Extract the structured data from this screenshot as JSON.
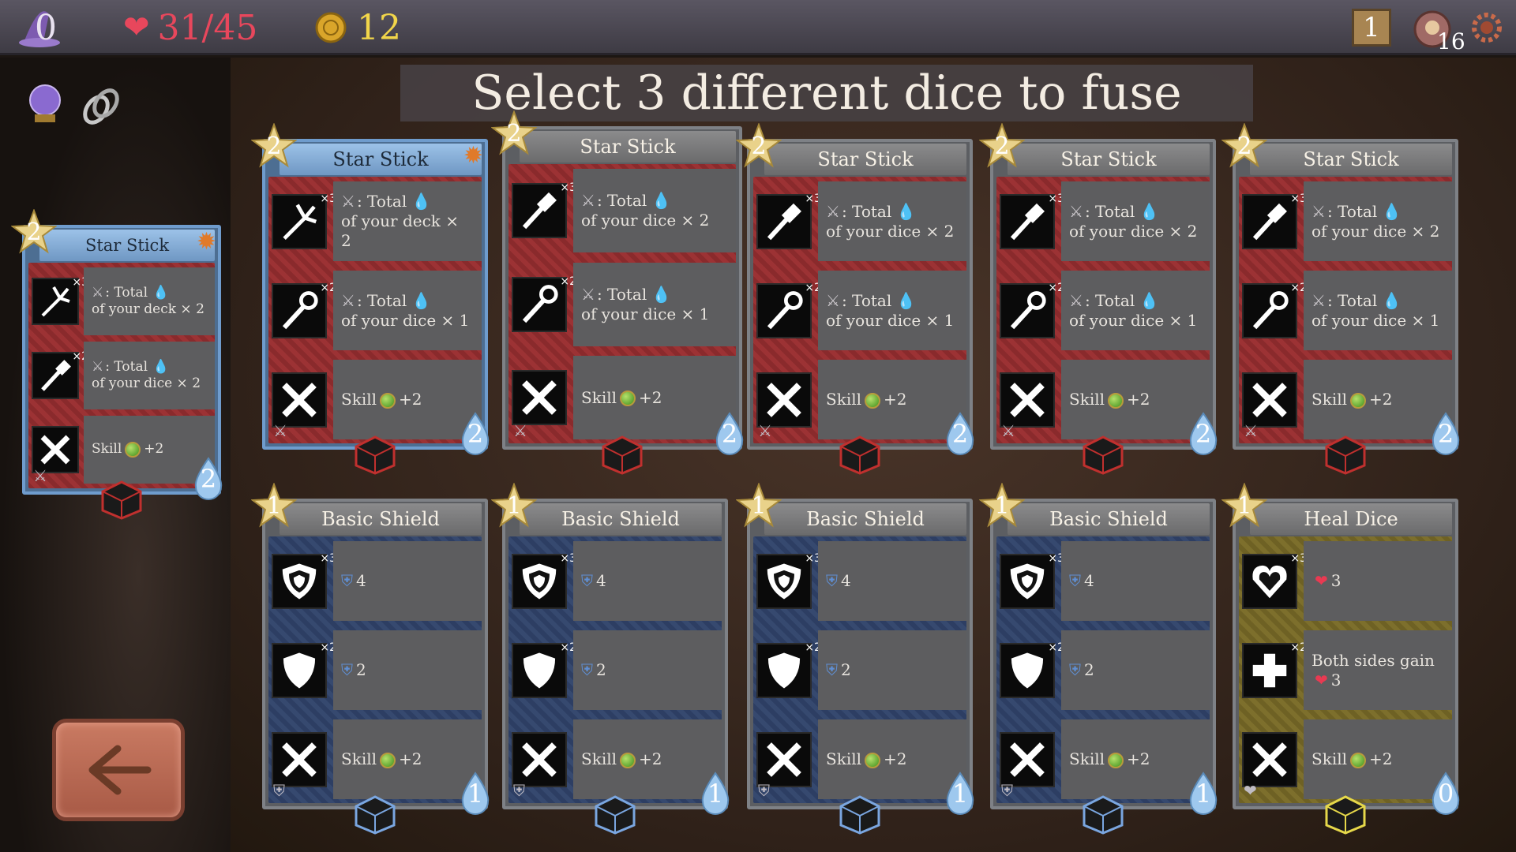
{
  "topbar": {
    "hat_count": "0",
    "health": "31/45",
    "gold": "12",
    "map_number": "1",
    "potion_count": "16"
  },
  "title": "Select 3 different dice to fuse",
  "left_card": {
    "name": "Star Stick",
    "level": "2",
    "cost": "2",
    "faces": [
      {
        "mult": "×3",
        "line1": ": Total",
        "line2": "of your deck × 2"
      },
      {
        "mult": "×2",
        "line1": ": Total",
        "line2": "of your dice × 2"
      },
      {
        "mult": "",
        "skill": "Skill",
        "skill_value": "+2"
      }
    ]
  },
  "row1": [
    {
      "name": "Star Stick",
      "level": "2",
      "cost": "2",
      "faces": [
        {
          "mult": "×3",
          "line1": ": Total",
          "line2": "of your deck × 2"
        },
        {
          "mult": "×2",
          "line1": ": Total",
          "line2": "of your dice × 1"
        },
        {
          "skill": "Skill",
          "skill_value": "+2"
        }
      ]
    },
    {
      "name": "Star Stick",
      "level": "2",
      "cost": "2",
      "faces": [
        {
          "mult": "×3",
          "line1": ": Total",
          "line2": "of your dice × 2"
        },
        {
          "mult": "×2",
          "line1": ": Total",
          "line2": "of your dice × 1"
        },
        {
          "skill": "Skill",
          "skill_value": "+2"
        }
      ]
    },
    {
      "name": "Star Stick",
      "level": "2",
      "cost": "2",
      "faces": [
        {
          "mult": "×3",
          "line1": ": Total",
          "line2": "of your dice × 2"
        },
        {
          "mult": "×2",
          "line1": ": Total",
          "line2": "of your dice × 1"
        },
        {
          "skill": "Skill",
          "skill_value": "+2"
        }
      ]
    },
    {
      "name": "Star Stick",
      "level": "2",
      "cost": "2",
      "faces": [
        {
          "mult": "×3",
          "line1": ": Total",
          "line2": "of your dice × 2"
        },
        {
          "mult": "×2",
          "line1": ": Total",
          "line2": "of your dice × 1"
        },
        {
          "skill": "Skill",
          "skill_value": "+2"
        }
      ]
    },
    {
      "name": "Star Stick",
      "level": "2",
      "cost": "2",
      "faces": [
        {
          "mult": "×3",
          "line1": ": Total",
          "line2": "of your dice × 2"
        },
        {
          "mult": "×2",
          "line1": ": Total",
          "line2": "of your dice × 1"
        },
        {
          "skill": "Skill",
          "skill_value": "+2"
        }
      ]
    }
  ],
  "row2": [
    {
      "name": "Basic Shield",
      "level": "1",
      "cost": "1",
      "faces": [
        {
          "mult": "×3",
          "value": "4"
        },
        {
          "mult": "×2",
          "value": "2"
        },
        {
          "skill": "Skill",
          "skill_value": "+2"
        }
      ]
    },
    {
      "name": "Basic Shield",
      "level": "1",
      "cost": "1",
      "faces": [
        {
          "mult": "×3",
          "value": "4"
        },
        {
          "mult": "×2",
          "value": "2"
        },
        {
          "skill": "Skill",
          "skill_value": "+2"
        }
      ]
    },
    {
      "name": "Basic Shield",
      "level": "1",
      "cost": "1",
      "faces": [
        {
          "mult": "×3",
          "value": "4"
        },
        {
          "mult": "×2",
          "value": "2"
        },
        {
          "skill": "Skill",
          "skill_value": "+2"
        }
      ]
    },
    {
      "name": "Basic Shield",
      "level": "1",
      "cost": "1",
      "faces": [
        {
          "mult": "×3",
          "value": "4"
        },
        {
          "mult": "×2",
          "value": "2"
        },
        {
          "skill": "Skill",
          "skill_value": "+2"
        }
      ]
    },
    {
      "name": "Heal Dice",
      "level": "1",
      "cost": "0",
      "faces": [
        {
          "mult": "×3",
          "value": "3"
        },
        {
          "mult": "×2",
          "line1": "Both sides gain",
          "value": "3"
        },
        {
          "skill": "Skill",
          "skill_value": "+2"
        }
      ]
    }
  ],
  "colors": {
    "attack_bg": "#8a2a2c",
    "shield_bg": "#2d3e63",
    "heal_bg": "#6e6124",
    "health_text": "#e83a52",
    "gold_text": "#f2d64a",
    "selected_border": "#6f9ccd"
  }
}
